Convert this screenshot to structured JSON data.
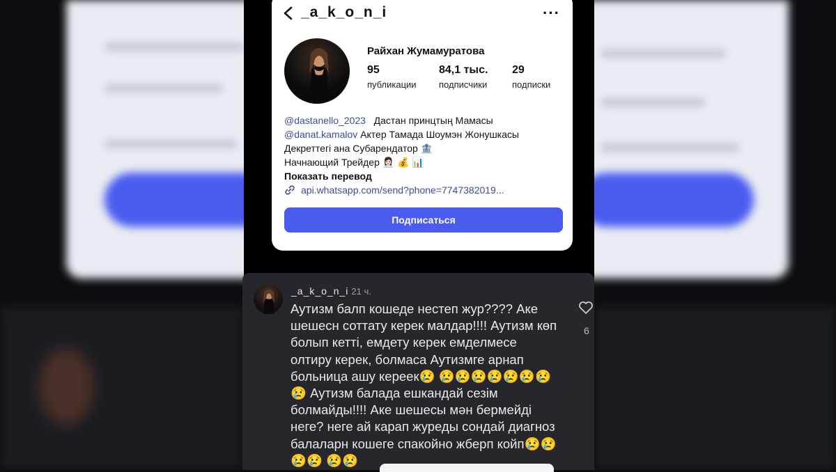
{
  "profile": {
    "username": "_a_k_o_n_i",
    "more_label": "···",
    "full_name": "Райхан Жумамуратова",
    "stats": [
      {
        "value": "95",
        "label": "публикации"
      },
      {
        "value": "84,1 тыс.",
        "label": "подписчики"
      },
      {
        "value": "29",
        "label": "подписки"
      }
    ],
    "bio": {
      "line1_mention": "@dastanello_2023",
      "line1_text": "Дастан принцтың Мамасы",
      "line2_mention": "@danat.kamalov",
      "line2_text": "Актер Тамада Шоумэн Жонушкасы",
      "line3": "Декреттегі ана Субарендатор 🏦",
      "line4": "Начнающий Трейдер 👩🏻‍💼 💰 📊",
      "translate": "Показать перевод",
      "link": "api.whatsapp.com/send?phone=7747382019..."
    },
    "subscribe_label": "Подписаться"
  },
  "comment": {
    "username": "_a_k_o_n_i",
    "time": "21 ч.",
    "text": "Аутизм балп кошеде нестеп жур???? Аке шешесн соттату керек малдар!!!! Аутизм көп болып кетті, емдету керек емделмесе олтиру керек, болмаса Аутизмге арнап больница ашу кереек😢 😢😢😢😢😢😢😢😢 Аутизм балада ешкандай сезім болмайды!!!! Аке шешесы мән бермейді неге? неге ай карап журеды сондай диагноз балаларн кошеге спакойно жберп койп😢😢😢😢 😢😢",
    "likes": "6"
  },
  "colors": {
    "accent": "#4a5cf0",
    "mention": "#3d4b9a",
    "comment_bg": "#25272c"
  },
  "icons": [
    "back-arrow-icon",
    "more-icon",
    "link-icon",
    "heart-icon"
  ]
}
